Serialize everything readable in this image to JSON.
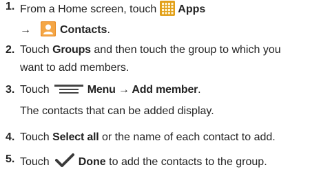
{
  "steps": [
    {
      "number": "1.",
      "line1": {
        "before": "From a Home screen, touch",
        "icon": "apps-grid-icon",
        "bold": "Apps"
      },
      "line2": {
        "arrow": "→",
        "icon": "contacts-icon",
        "bold": "Contacts",
        "after": "."
      }
    },
    {
      "number": "2.",
      "line1": {
        "before": "Touch",
        "bold": "Groups",
        "after": "and then touch the group to which you"
      },
      "line2": {
        "text": "want to add members."
      }
    },
    {
      "number": "3.",
      "line1": {
        "before": "Touch",
        "icon": "menu-icon",
        "bold": "Menu → Add member",
        "after": "."
      },
      "line2": {
        "text": "The contacts that can be added display."
      }
    },
    {
      "number": "4.",
      "line1": {
        "before": "Touch",
        "bold": "Select all",
        "after": "or the name of each contact to add."
      }
    },
    {
      "number": "5.",
      "line1": {
        "before": "Touch",
        "icon": "checkmark-icon",
        "bold": "Done",
        "after": "to add the contacts to the group."
      }
    }
  ],
  "colors": {
    "apps_icon_bg": "#e8a91e",
    "apps_icon_grid": "#fff6d8",
    "contacts_icon_bg": "#e98a22",
    "menu_icon_bar": "#444444",
    "check_icon": "#3a3a3a"
  }
}
